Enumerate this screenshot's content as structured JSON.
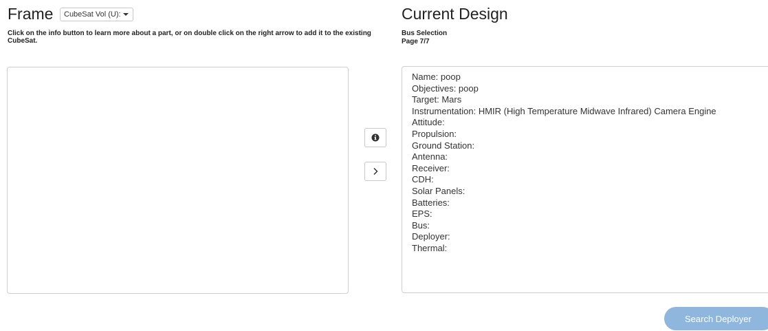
{
  "left_panel": {
    "title": "Frame",
    "dropdown_selected": "CubeSat Vol (U):",
    "instructions": "Click on the info button to learn more about a part, or on double click on the right arrow to add it to the existing CubeSat."
  },
  "controls": {
    "info_icon": "info-circle-icon",
    "add_icon": "chevron-right-icon"
  },
  "right_panel": {
    "title": "Current Design",
    "section": "Bus Selection",
    "page": "Page 7/7",
    "design_lines": [
      "Name: poop",
      "Objectives: poop",
      "Target: Mars",
      "Instrumentation: HMIR (High Temperature Midwave Infrared) Camera Engine",
      "Attitude:",
      "Propulsion:",
      "Ground Station:",
      "Antenna:",
      "Receiver:",
      "CDH:",
      "Solar Panels:",
      "Batteries:",
      "EPS:",
      "Bus:",
      "Deployer:",
      "Thermal:"
    ]
  },
  "footer": {
    "search_button_label": "Search Deployer"
  },
  "colors": {
    "primary_button": "#8fb6dc",
    "border": "#cfcfcf",
    "text": "#222222"
  }
}
